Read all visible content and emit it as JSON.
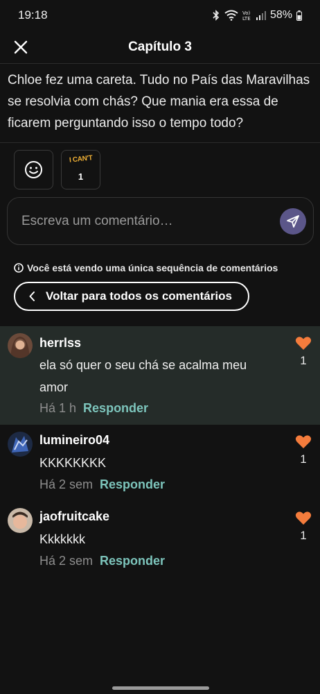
{
  "status_bar": {
    "time": "19:18",
    "battery": "58%",
    "icons": [
      "bluetooth-icon",
      "wifi-icon",
      "volte-icon",
      "signal-icon",
      "battery-icon"
    ]
  },
  "header": {
    "title": "Capítulo 3",
    "close_icon": "close-icon"
  },
  "excerpt": {
    "text": "Chloe fez uma careta. Tudo no País das Maravilhas se resolvia com chás? Que mania era essa de ficarem perguntando isso o tempo todo?"
  },
  "reactions": {
    "add_icon": "smiley-icon",
    "sticker_label": "I CAN'T",
    "sticker_count": "1"
  },
  "comment_input": {
    "placeholder": "Escreva um comentário…",
    "value": "",
    "send_icon": "send-icon"
  },
  "thread_notice": {
    "text": "Você está vendo uma única sequência de comentários",
    "icon": "info-icon"
  },
  "back_button": {
    "label": "Voltar para todos os comentários",
    "icon": "chevron-left-icon"
  },
  "comments": [
    {
      "username": "herrlss",
      "text": "ela só quer o seu chá se acalma meu amor",
      "time": "Há 1 h",
      "reply_label": "Responder",
      "likes": "1",
      "highlighted": true
    },
    {
      "username": "lumineiro04",
      "text": "KKKKKKKK",
      "time": "Há 2 sem",
      "reply_label": "Responder",
      "likes": "1",
      "highlighted": false
    },
    {
      "username": "jaofruitcake",
      "text": "Kkkkkkk",
      "time": "Há 2 sem",
      "reply_label": "Responder",
      "likes": "1",
      "highlighted": false
    }
  ],
  "colors": {
    "background": "#121212",
    "highlight_row": "#252c29",
    "reply_link": "#7dc5bc",
    "heart": "#f47c3c",
    "send_button": "#5b5689"
  }
}
